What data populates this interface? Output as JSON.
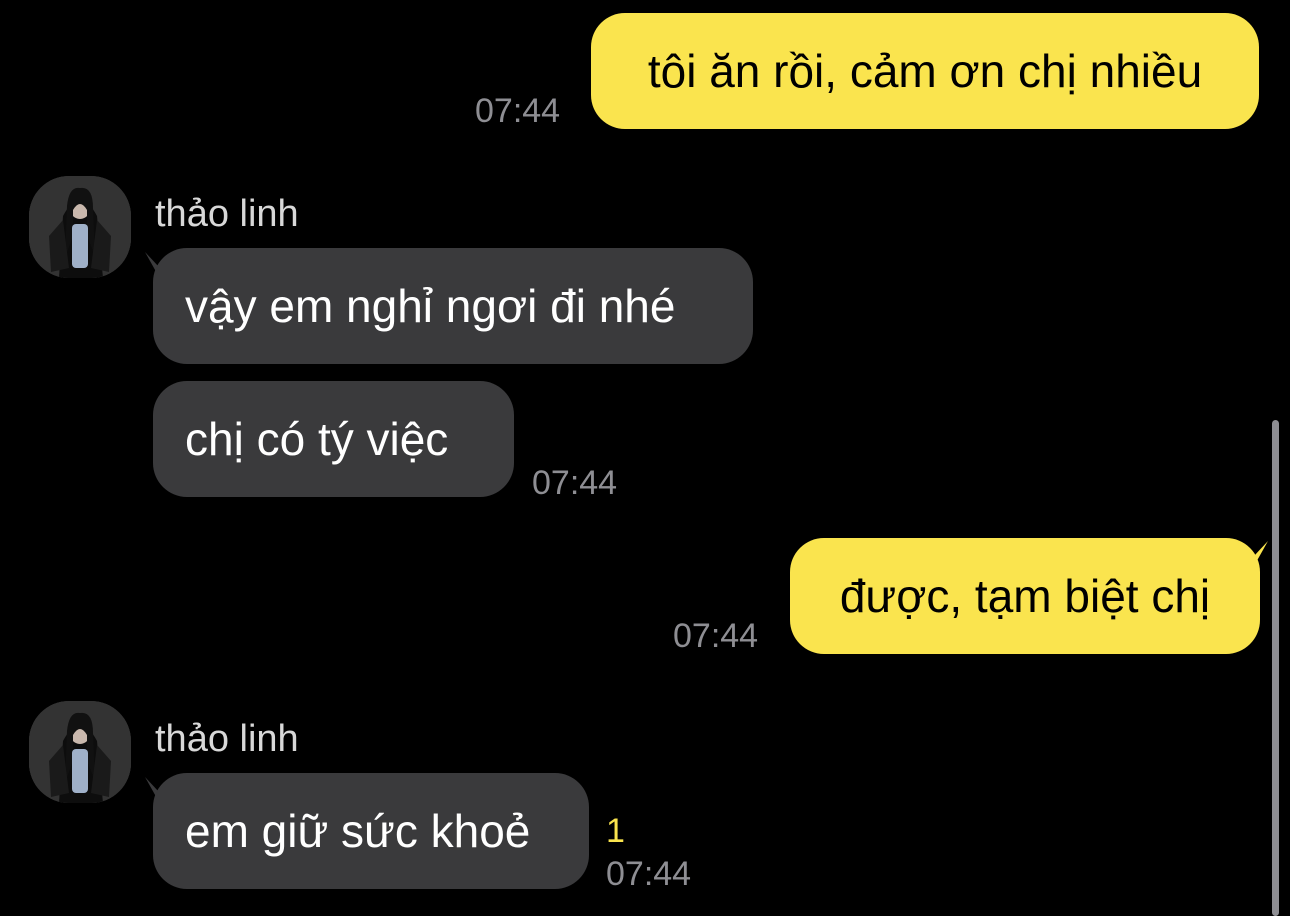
{
  "chat": {
    "messages": [
      {
        "from": "me",
        "text": "tôi ăn rồi, cảm ơn chị nhiều",
        "time": "07:44"
      },
      {
        "from": "contact",
        "sender": "thảo linh",
        "text": "vậy em nghỉ ngơi đi nhé"
      },
      {
        "from": "contact",
        "text": "chị có tý việc",
        "time": "07:44"
      },
      {
        "from": "me",
        "text": "được, tạm biệt chị",
        "time": "07:44"
      },
      {
        "from": "contact",
        "sender": "thảo linh",
        "text": "em giữ sức khoẻ",
        "unread_count": "1",
        "time": "07:44"
      }
    ]
  },
  "colors": {
    "background": "#000000",
    "my_bubble": "#fae44e",
    "their_bubble": "#3a3a3c",
    "timestamp": "#8e8e93",
    "unread": "#fae44e"
  },
  "icons": {
    "avatar": "contact-avatar-photo"
  }
}
